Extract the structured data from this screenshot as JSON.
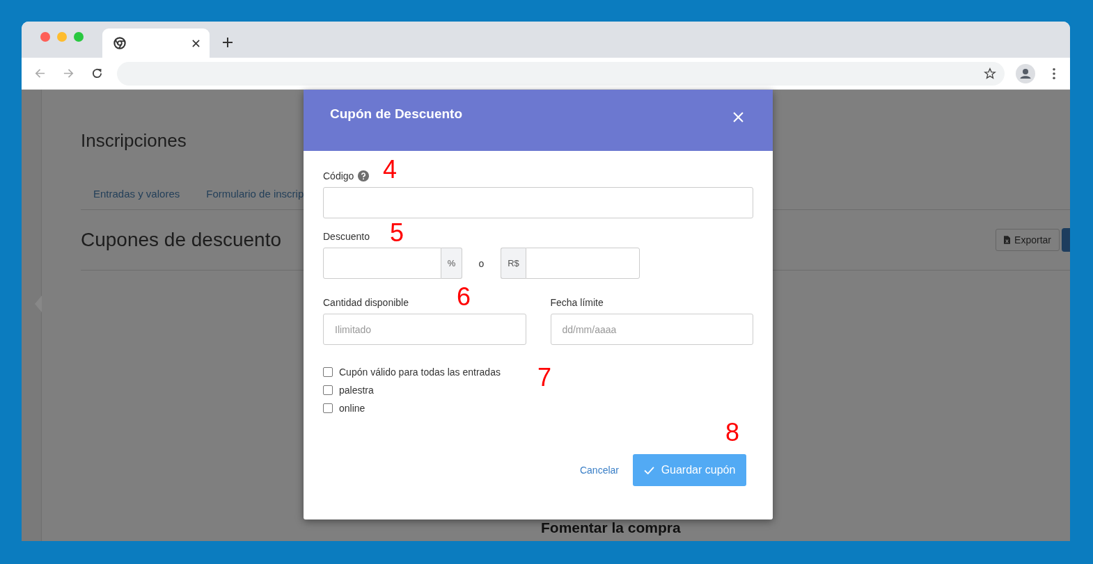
{
  "page": {
    "title": "Inscripciones",
    "tabs": [
      {
        "label": "Entradas y valores"
      },
      {
        "label": "Formulario de inscrip"
      }
    ],
    "section_title": "Cupones de descuento",
    "export_button": "Exportar",
    "subheading": "Fomentar la compra"
  },
  "modal": {
    "title": "Cupón de Descuento",
    "code": {
      "label": "Código"
    },
    "discount": {
      "label": "Descuento",
      "percent_addon": "%",
      "separator": "o",
      "currency_addon": "R$"
    },
    "quantity": {
      "label": "Cantidad disponible",
      "placeholder": "Ilimitado"
    },
    "deadline": {
      "label": "Fecha límite",
      "placeholder": "dd/mm/aaaa"
    },
    "checkboxes": [
      {
        "label": "Cupón válido para todas las entradas",
        "checked": false
      },
      {
        "label": "palestra",
        "checked": false
      },
      {
        "label": "online",
        "checked": false
      }
    ],
    "cancel": "Cancelar",
    "save": "Guardar cupón"
  },
  "annotations": [
    {
      "text": "4"
    },
    {
      "text": "5"
    },
    {
      "text": "6"
    },
    {
      "text": "7"
    },
    {
      "text": "8"
    }
  ]
}
